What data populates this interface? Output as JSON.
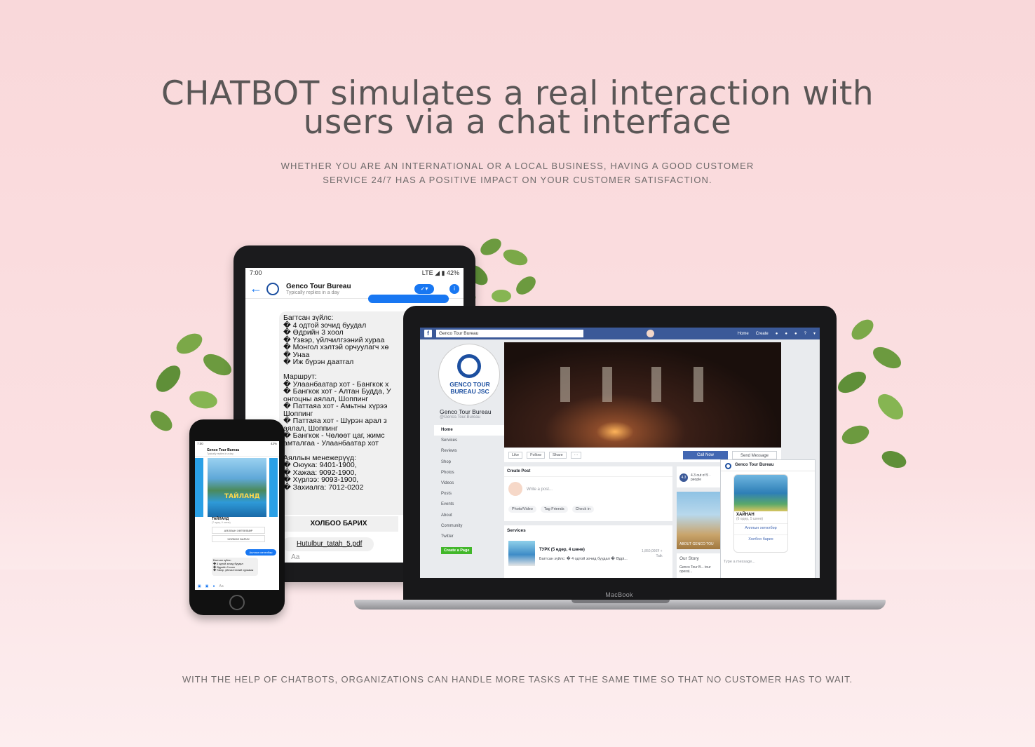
{
  "hero": {
    "title_line1": "CHATBOT simulates a real interaction with",
    "title_line2": "users via a chat interface",
    "subtitle_line1": "WHETHER YOU ARE AN INTERNATIONAL OR A LOCAL BUSINESS, HAVING A GOOD CUSTOMER",
    "subtitle_line2": "SERVICE 24/7 HAS A POSITIVE IMPACT ON YOUR CUSTOMER SATISFACTION."
  },
  "footer": {
    "text": "WITH THE HELP OF CHATBOTS, ORGANIZATIONS CAN HANDLE MORE TASKS AT THE SAME TIME SO THAT NO CUSTOMER HAS TO WAIT."
  },
  "tablet": {
    "time": "7:00",
    "battery": "LTE ◢ ▮ 42%",
    "page_name": "Genco Tour Bureau",
    "page_status": "Typically replies in a day",
    "message": "Багтсан зүйлс:\n� 4 одтой зочид буудал\n� Өдрийн 3 хоол\n� Үзвэр, үйлчилгээний хураа\n� Монгол хэлтэй орчуулагч хө\n� Унаа\n� Иж бүрэн даатгал\n\nМаршрут:\n� Улаанбаатар хот - Бангкок х\n� Бангкок хот - Алтан Будда, У\nонгоцны аялал, Шоппинг\n� Паттаяа хот - Амьтны хүрээ\nШоппинг\n� Паттаяа хот - Шүрэн арал з\nаялал, Шоппинг\n� Бангкок - Чөлөөт цаг, жимс\nамталгаа - Улаанбаатар хот\n\nАяллын менежерүүд:\n� Оюука: 9401-1900,\n� Хажаа: 9092-1900,\n� Хүрлээ: 9093-1900,\n� Захиалга: 7012-0202",
    "cta_label": "ХОЛБОО БАРИХ",
    "attachment": "Hutulbur_tatah_5.pdf",
    "input_placeholder": "Aa"
  },
  "laptop": {
    "brand": "MacBook",
    "search_value": "Genco Tour Bureau",
    "nav_home": "Home",
    "nav_create": "Create",
    "logo_text_line1": "GENCO TOUR",
    "logo_text_line2": "BUREAU JSC",
    "page_name": "Genco Tour Bureau",
    "page_handle": "@Genco.Tour.Bureau",
    "menu": [
      "Home",
      "Services",
      "Reviews",
      "Shop",
      "Photos",
      "Videos",
      "Posts",
      "Events",
      "About",
      "Community",
      "Twitter"
    ],
    "create_page": "Create a Page",
    "action_like": "Like",
    "action_follow": "Follow",
    "action_share": "Share",
    "action_more": "···",
    "call_now": "Call Now",
    "send_message": "Send Message",
    "create_post": "Create Post",
    "write_post": "Write a post...",
    "post_photo": "Photo/Video",
    "post_tag": "Tag Friends",
    "post_checkin": "Check in",
    "services_title": "Services",
    "service_name": "ТУРК (5 өдөр, 4 шөнө)",
    "service_desc": "Багтсан зүйлс: � 4 одтой зочид буудал � Өдрі...",
    "service_price_line1": "1,850,000₮ +",
    "service_price_line2": "Tatk",
    "rating": "4.3",
    "rating_text_line1": "4.3 out of 5 ·",
    "rating_text_line2": "people",
    "about_label": "ABOUT GENCO TOU",
    "our_story": "Our Story",
    "story_snippet": "Genco Tour B... tour operat...",
    "msgr_name": "Genco Tour Bureau",
    "msgr_card_title": "ХАЙНАН",
    "msgr_card_sub": "(6 өдөр, 5 шөнө)",
    "msgr_btn1": "Аяллын хөтөлбөр",
    "msgr_btn2": "Холбоо барих",
    "msgr_input": "Type a message..."
  },
  "phone": {
    "time": "7:00",
    "battery": "42%",
    "page_name": "Genco Tour Bureau",
    "page_status": "Typically replies in a day",
    "card_overlay": "ТАЙЛАНД",
    "card_title": "ТАЙЛАНД",
    "card_sub": "(7 өдөр, 6 шөнө)",
    "btn1": "АЯЛЛЫН ХӨТӨЛБӨР",
    "btn2": "ХОЛБОО БАРИХ",
    "user_reply": "Аяллын хөтөлбөр",
    "message": "Багтсан зүйлс:\n� 4 одтой зочид буудал\n� Өдрийн 3 хоол\n� Үзвэр, үйлчилгээний хураамж",
    "input_placeholder": "Aa"
  },
  "colors": {
    "background": "#f9d8da",
    "headline": "#5a5656",
    "messenger_blue": "#1877f2",
    "facebook_blue": "#3b5998",
    "brand_blue": "#1c4fa0"
  }
}
